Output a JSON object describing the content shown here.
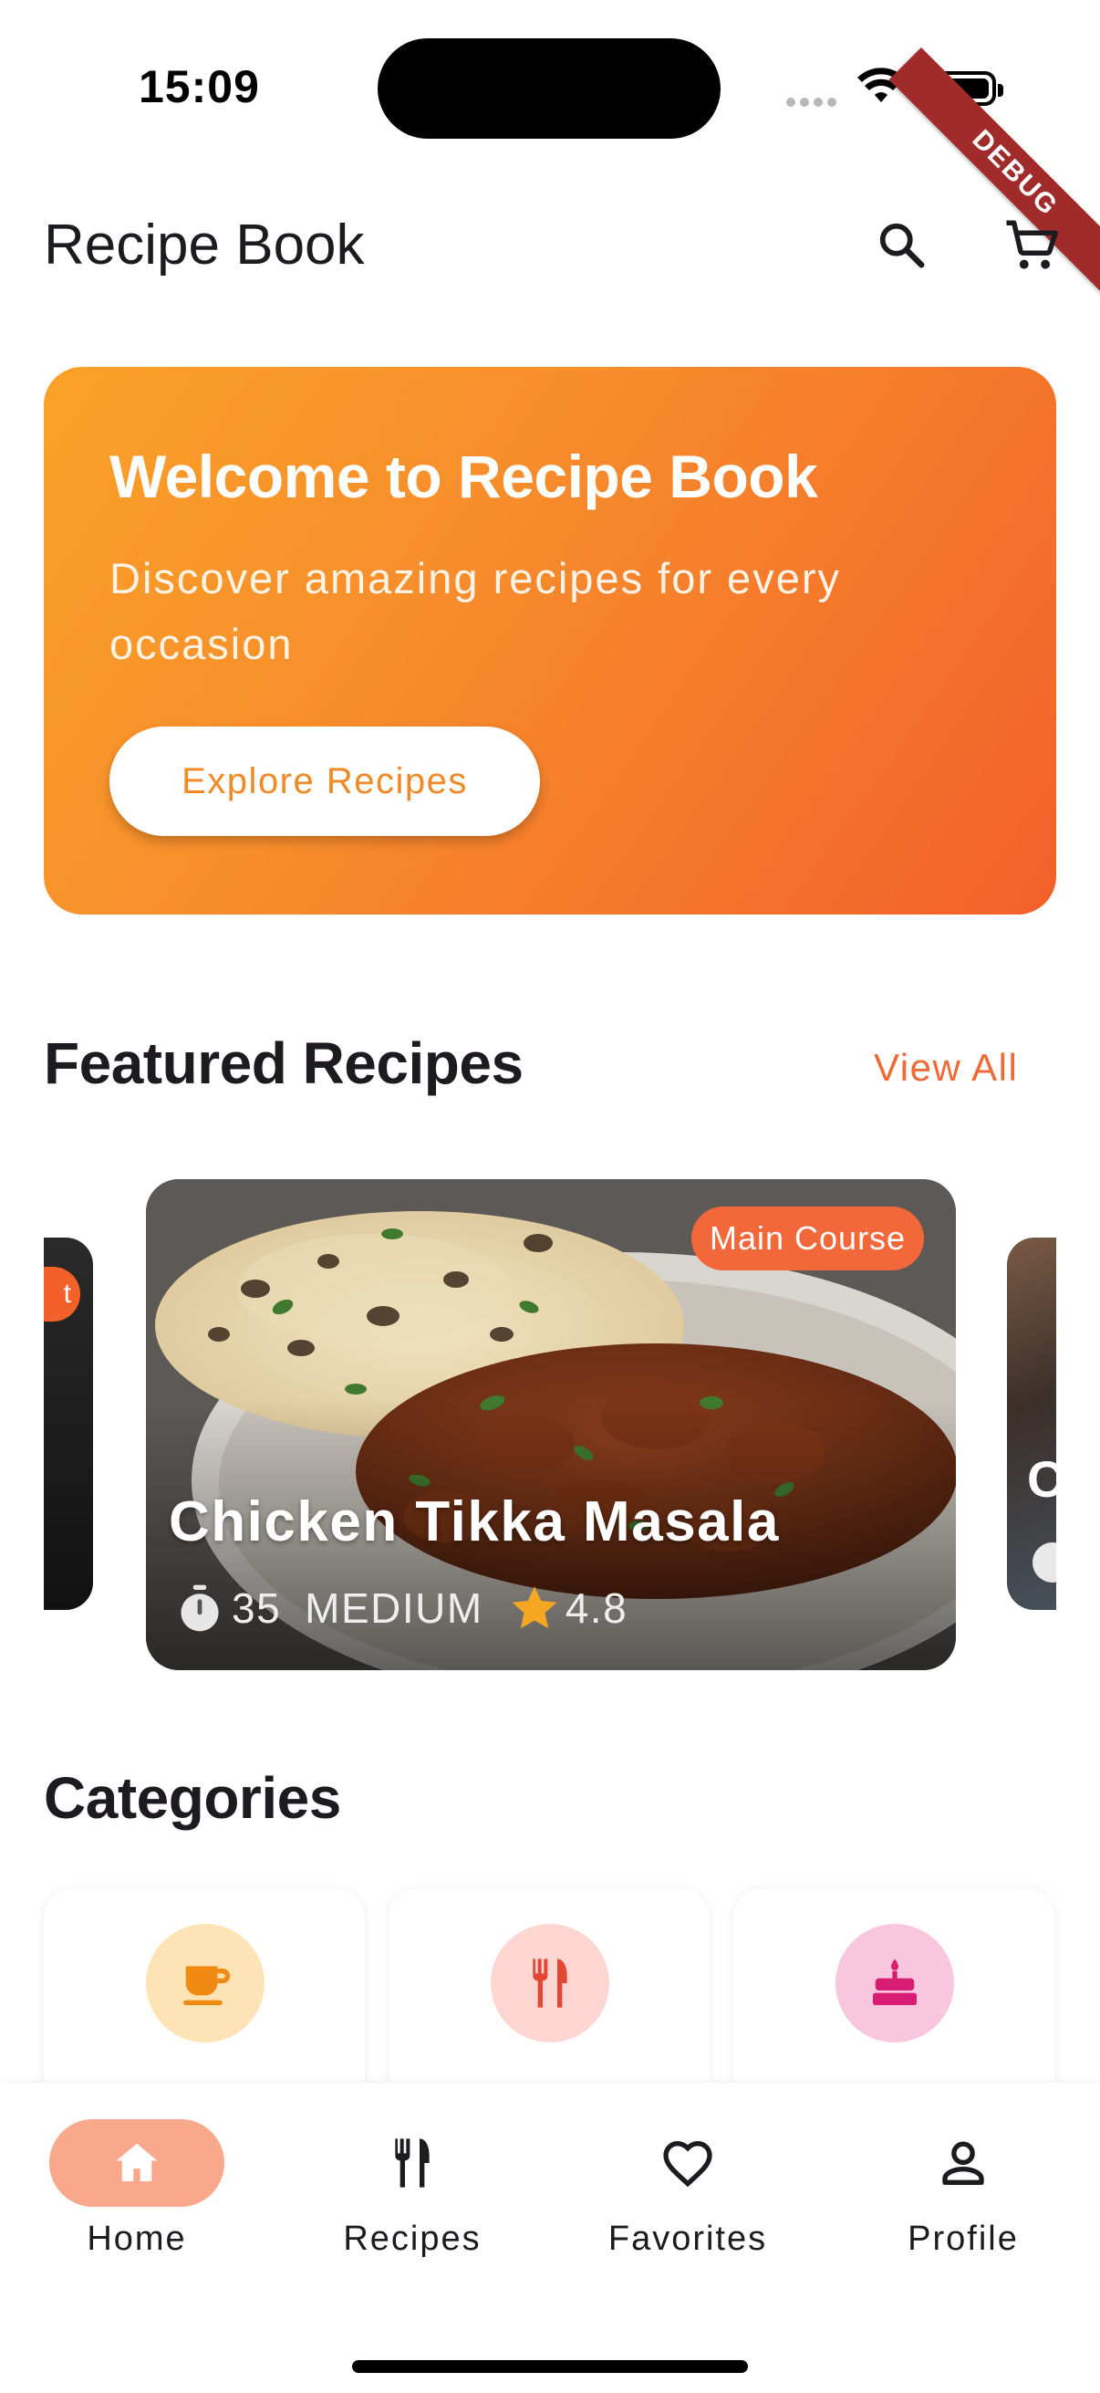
{
  "status_bar": {
    "time": "15:09",
    "debug_label": "DEBUG"
  },
  "app_bar": {
    "title": "Recipe Book",
    "search_icon": "search-icon",
    "cart_icon": "cart-icon"
  },
  "banner": {
    "title": "Welcome to Recipe Book",
    "subtitle": "Discover amazing recipes for every occasion",
    "button_label": "Explore Recipes",
    "gradient_colors": [
      "#fba128",
      "#f3602a"
    ]
  },
  "featured": {
    "title": "Featured Recipes",
    "view_all_label": "View All",
    "left_peek_badge": "t",
    "right_peek_letter": "C",
    "card": {
      "category": "Main Course",
      "title": "Chicken Tikka Masala",
      "time": "35",
      "difficulty": "MEDIUM",
      "rating": "4.8",
      "time_icon": "timer-icon",
      "rating_icon": "star-icon"
    }
  },
  "categories": {
    "title": "Categories",
    "items": [
      {
        "icon": "coffee-cup-icon",
        "bg": "#fde3b6",
        "color": "#f08a12"
      },
      {
        "icon": "fork-knife-icon",
        "bg": "#fdd6d2",
        "color": "#e24735"
      },
      {
        "icon": "cake-icon",
        "bg": "#f9c7dd",
        "color": "#d81b73"
      }
    ]
  },
  "bottom_nav": {
    "active": "Home",
    "accent": "#f9a88c",
    "items": [
      {
        "label": "Home",
        "icon": "home-icon"
      },
      {
        "label": "Recipes",
        "icon": "fork-knife-icon"
      },
      {
        "label": "Favorites",
        "icon": "heart-icon"
      },
      {
        "label": "Profile",
        "icon": "person-icon"
      }
    ]
  }
}
